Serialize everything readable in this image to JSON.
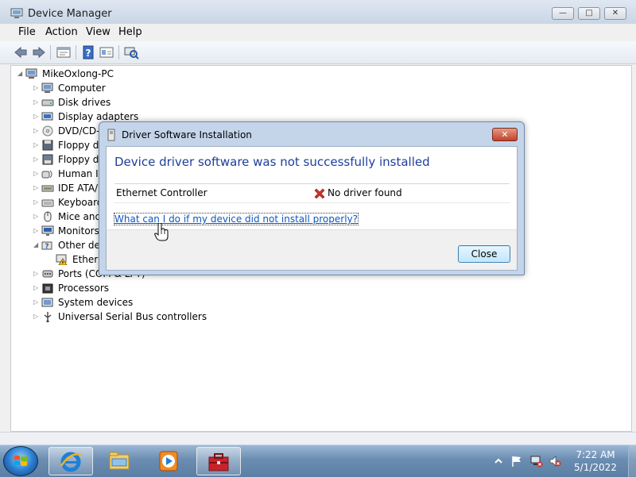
{
  "window": {
    "title": "Device Manager",
    "minimize_label": "—",
    "maximize_label": "□",
    "close_label": "✕"
  },
  "menu": {
    "items": [
      "File",
      "Action",
      "View",
      "Help"
    ]
  },
  "toolbar": {
    "buttons": [
      "back-icon",
      "forward-icon",
      "properties-icon",
      "help-icon",
      "show-hidden-icon",
      "scan-hardware-icon"
    ]
  },
  "tree": {
    "root": "MikeOxlong-PC",
    "items": [
      {
        "label": "Computer",
        "icon": "computer-icon"
      },
      {
        "label": "Disk drives",
        "icon": "disk-drive-icon"
      },
      {
        "label": "Display adapters",
        "icon": "display-adapter-icon"
      },
      {
        "label": "DVD/CD-",
        "icon": "dvd-icon"
      },
      {
        "label": "Floppy d",
        "icon": "floppy-icon"
      },
      {
        "label": "Floppy d",
        "icon": "floppy-controller-icon"
      },
      {
        "label": "Human I",
        "icon": "hid-icon"
      },
      {
        "label": "IDE ATA/",
        "icon": "ide-icon"
      },
      {
        "label": "Keyboard",
        "icon": "keyboard-icon"
      },
      {
        "label": "Mice and",
        "icon": "mouse-icon"
      },
      {
        "label": "Monitors",
        "icon": "monitor-icon"
      },
      {
        "label": "Other de",
        "icon": "other-devices-icon"
      },
      {
        "label": "Ether",
        "icon": "warning-device-icon"
      },
      {
        "label": "Ports (COM & LPT)",
        "icon": "port-icon"
      },
      {
        "label": "Processors",
        "icon": "processor-icon"
      },
      {
        "label": "System devices",
        "icon": "system-devices-icon"
      },
      {
        "label": "Universal Serial Bus controllers",
        "icon": "usb-icon"
      }
    ]
  },
  "dialog": {
    "title": "Driver Software Installation",
    "close_label": "✕",
    "heading": "Device driver software was not successfully installed",
    "device_name": "Ethernet Controller",
    "device_status": "No driver found",
    "help_link": "What can I do if my device did not install properly?",
    "button_close": "Close"
  },
  "taskbar": {
    "apps": [
      "internet-explorer-icon",
      "explorer-icon",
      "media-player-icon",
      "device-manager-icon"
    ],
    "tray_icons": [
      "show-hidden-icons-chevron",
      "action-center-flag-icon",
      "network-icon",
      "volume-muted-icon"
    ],
    "time": "7:22 AM",
    "date": "5/1/2022"
  },
  "colors": {
    "heading_blue": "#1e3e9c",
    "link_blue": "#0b58c4",
    "error_red": "#d0312a"
  }
}
